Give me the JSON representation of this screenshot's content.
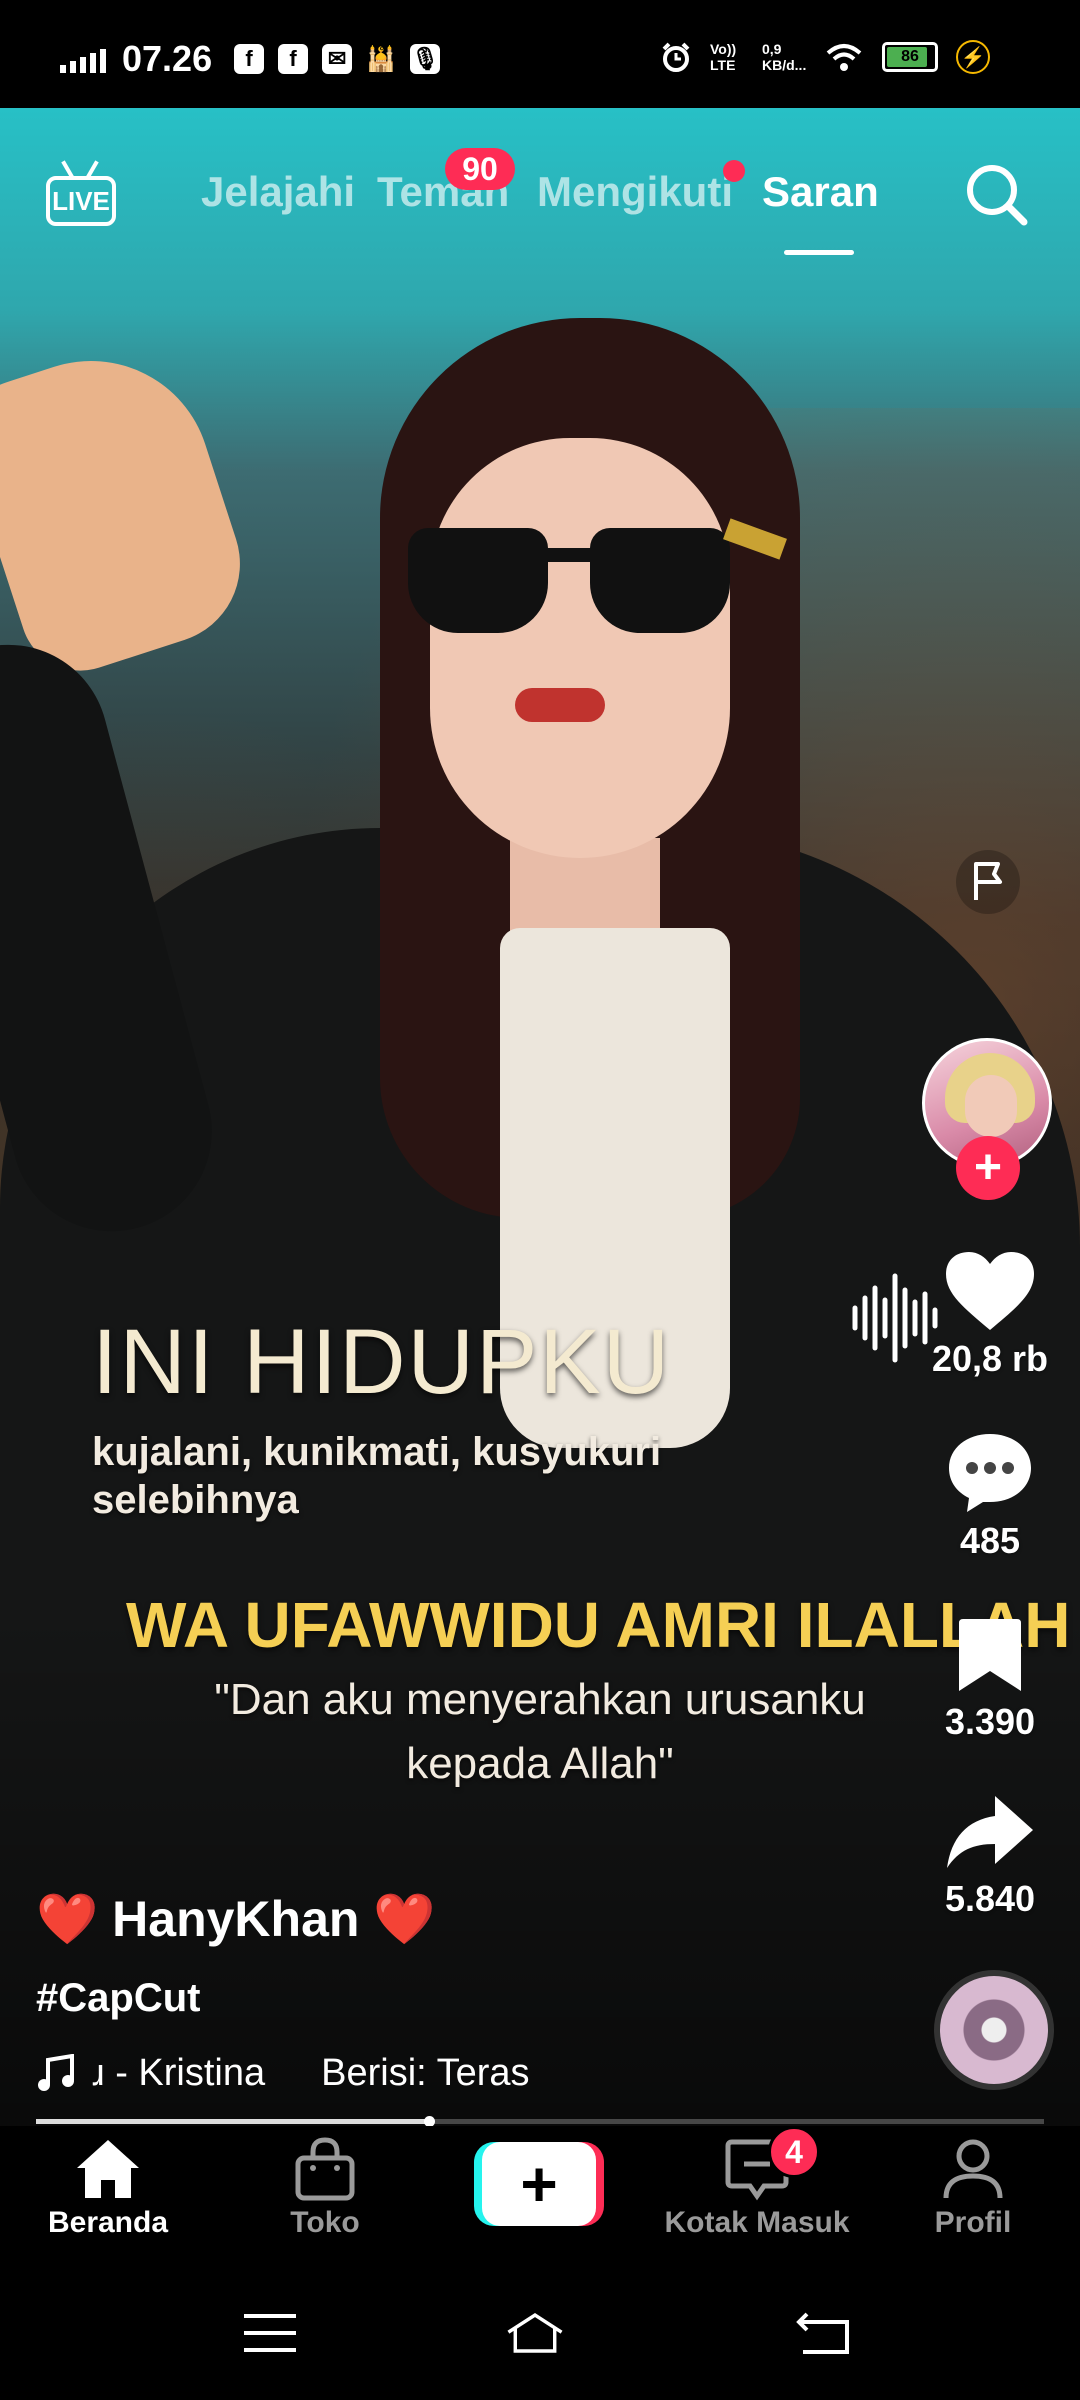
{
  "status_bar": {
    "time": "07.26",
    "notif_icons": [
      "f",
      "f",
      "✉",
      "🕌",
      "🎙"
    ],
    "network_text": "0,9\nKB/d...",
    "volte": "Vo)) LTE",
    "battery": "86"
  },
  "top_nav": {
    "live_label": "LIVE",
    "tabs": [
      {
        "label": "Jelajahi"
      },
      {
        "label": "Teman",
        "badge": "90"
      },
      {
        "label": "Mengikuti"
      },
      {
        "label": "Saran"
      }
    ]
  },
  "video": {
    "caption_title": "INI HIDUPKU",
    "caption_sub": "kujalani, kunikmati, kusyukuri selebihnya",
    "caption_arabic": "WA UFAWWIDU AMRI ILALLAH",
    "caption_translation": "\"Dan aku menyerahkan urusanku kepada Allah\""
  },
  "actions": {
    "likes": "20,8 rb",
    "comments": "485",
    "bookmarks": "3.390",
    "shares": "5.840"
  },
  "post": {
    "author": "❤️ HanyKhan ❤️",
    "hashtag": "#CapCut",
    "sound": "ɹ - Kristina",
    "content_label": "Berisi: Teras",
    "progress": 0.39
  },
  "bottom_nav": {
    "items": [
      {
        "label": "Beranda"
      },
      {
        "label": "Toko"
      },
      {
        "label": "Kotak Masuk",
        "badge": "4"
      },
      {
        "label": "Profil"
      }
    ]
  },
  "colors": {
    "accent": "#fe2c55",
    "cyan": "#25f4ee",
    "caption_gold": "#f5cf54"
  }
}
